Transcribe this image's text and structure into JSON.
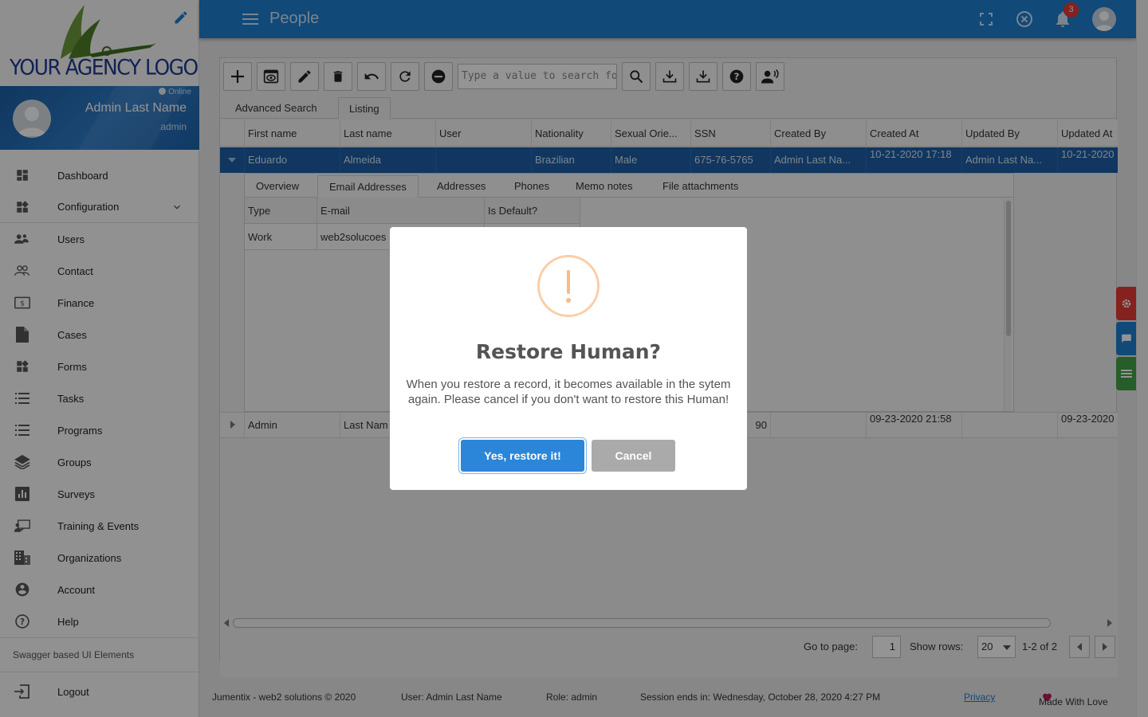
{
  "app": {
    "logo_text": "YOUR AGENCY LOGO",
    "page_title": "People",
    "notification_count": "3",
    "accent_color": "#1e7fd0"
  },
  "user": {
    "status": "Online",
    "name": "Admin Last Name",
    "role": "admin"
  },
  "sidebar": {
    "items": [
      {
        "label": "Dashboard",
        "icon": "dashboard-icon"
      },
      {
        "label": "Configuration",
        "icon": "widgets-icon"
      },
      {
        "label": "Users",
        "icon": "users-group-icon"
      },
      {
        "label": "Contact",
        "icon": "people-outline-icon"
      },
      {
        "label": "Finance",
        "icon": "money-icon"
      },
      {
        "label": "Cases",
        "icon": "document-icon"
      },
      {
        "label": "Forms",
        "icon": "widgets-icon"
      },
      {
        "label": "Tasks",
        "icon": "list-icon"
      },
      {
        "label": "Programs",
        "icon": "list-icon"
      },
      {
        "label": "Groups",
        "icon": "layers-icon"
      },
      {
        "label": "Surveys",
        "icon": "chart-icon"
      },
      {
        "label": "Training & Events",
        "icon": "presentation-icon"
      },
      {
        "label": "Organizations",
        "icon": "building-icon"
      },
      {
        "label": "Account",
        "icon": "account-circle-icon"
      },
      {
        "label": "Help",
        "icon": "help-circle-icon"
      }
    ],
    "section_label": "Swagger based UI Elements",
    "logout": "Logout"
  },
  "toolbar": {
    "search_placeholder": "Type a value to search for Hu"
  },
  "tabs": [
    "Advanced Search",
    "Listing"
  ],
  "grid": {
    "columns": [
      "First name",
      "Last name",
      "User",
      "Nationality",
      "Sexual Orie...",
      "SSN",
      "Created By",
      "Created At",
      "Updated By",
      "Updated At"
    ],
    "rows": [
      {
        "first": "Eduardo",
        "last": "Almeida",
        "user": "",
        "nationality": "Brazilian",
        "sex": "Male",
        "ssn": "675-76-5765",
        "created_by": "Admin Last Na...",
        "created_at": "10-21-2020 17:18",
        "updated_by": "Admin Last Na...",
        "updated_at": "10-21-2020"
      },
      {
        "first": "Admin",
        "last": "Last Nam",
        "ssn": "90",
        "created_at": "09-23-2020 21:58",
        "updated_at": "09-23-2020"
      }
    ]
  },
  "detail": {
    "tabs": [
      "Overview",
      "Email Addresses",
      "Addresses",
      "Phones",
      "Memo notes",
      "File attachments"
    ],
    "columns": [
      "Type",
      "E-mail",
      "Is Default?"
    ],
    "row": {
      "type": "Work",
      "email": "web2solucoes"
    }
  },
  "pager": {
    "go_to_page": "Go to page:",
    "page": "1",
    "show_rows": "Show rows:",
    "rows": "20",
    "range": "1-2 of 2"
  },
  "footer": {
    "company": "Jumentix - web2 solutions © 2020",
    "user": "User: Admin Last Name",
    "role": "Role: admin",
    "session": "Session ends in: Wednesday, October 28, 2020 4:27 PM",
    "privacy": "Privacy",
    "made": "Made With Love"
  },
  "dialog": {
    "title": "Restore Human?",
    "text": "When you restore a record, it becomes available in the sytem again. Please cancel if you don't want to restore this Human!",
    "confirm": "Yes, restore it!",
    "cancel": "Cancel"
  }
}
